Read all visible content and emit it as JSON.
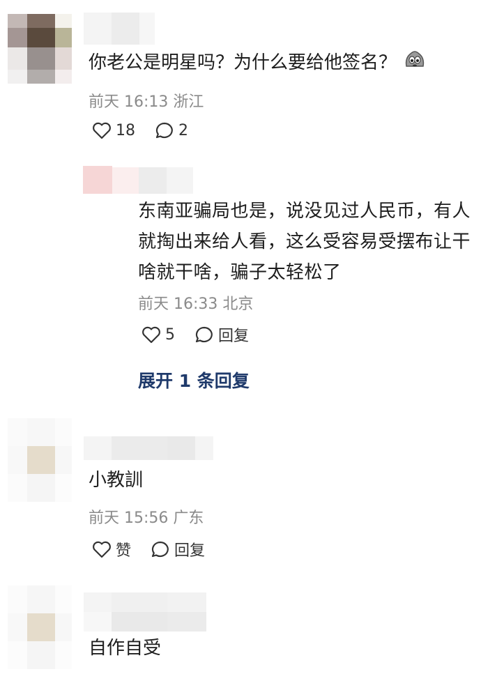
{
  "comments": [
    {
      "text": "你老公是明星吗？为什么要给他签名？",
      "emoji": "crying-face-icon",
      "meta": "前天 16:13 浙江",
      "like_count": "18",
      "reply_count": "2"
    },
    {
      "text": "东南亚骗局也是，说没见过人民币，有人就掏出来给人看，这么受容易受摆布让干啥就干啥，骗子太轻松了",
      "meta": "前天 16:33 北京",
      "like_count": "5",
      "reply_label": "回复",
      "expand": "展开 1 条回复"
    },
    {
      "text": "小教訓",
      "meta": "前天 15:56 广东",
      "like_label": "赞",
      "reply_label": "回复"
    },
    {
      "text": "自作自受"
    }
  ],
  "icons": {
    "like": "heart-outline-icon",
    "reply": "speech-bubble-icon"
  },
  "colors": {
    "meta_text": "#8a8a8a",
    "expand_link": "#1f3a6b"
  }
}
